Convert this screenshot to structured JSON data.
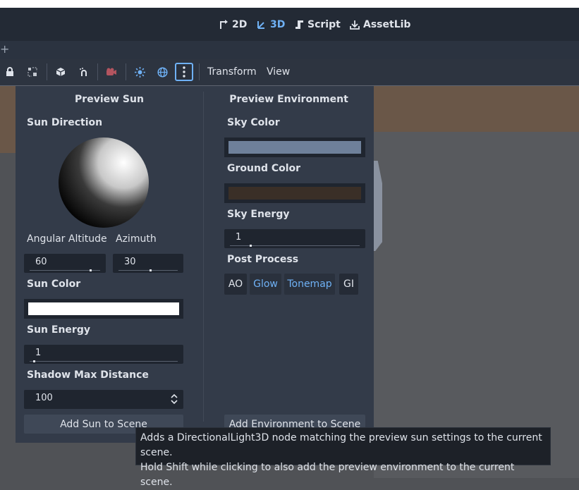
{
  "workspaces": [
    {
      "label": "2D",
      "icon": "2d-workspace-icon"
    },
    {
      "label": "3D",
      "icon": "3d-workspace-icon",
      "active": true
    },
    {
      "label": "Script",
      "icon": "script-icon"
    },
    {
      "label": "AssetLib",
      "icon": "assetlib-icon"
    }
  ],
  "colors": {
    "accent": "#6fb1f5",
    "panel_bg": "#333b49",
    "sky_color": "#6e809a",
    "ground_color": "#3a2f27",
    "sun_color": "#ffffff"
  },
  "toolbar": {
    "icons": [
      "lock-icon",
      "group-icon",
      "cube-icon",
      "snap-icon",
      "film-icon",
      "sun-icon",
      "globe-icon",
      "more-vertical-icon"
    ],
    "transform_label": "Transform",
    "view_label": "View"
  },
  "sun": {
    "heading": "Preview Sun",
    "direction_label": "Sun Direction",
    "altitude_label": "Angular Altitude",
    "azimuth_label": "Azimuth",
    "altitude_value": "60",
    "altitude_fraction": 0.86,
    "azimuth_value": "30",
    "azimuth_fraction": 0.54,
    "color_label": "Sun Color",
    "energy_label": "Sun Energy",
    "energy_value": "1",
    "energy_fraction": 0.03,
    "shadow_label": "Shadow Max Distance",
    "shadow_value": "100",
    "add_button": "Add Sun to Scene"
  },
  "env": {
    "heading": "Preview Environment",
    "sky_color_label": "Sky Color",
    "ground_color_label": "Ground Color",
    "sky_energy_label": "Sky Energy",
    "sky_energy_value": "1",
    "sky_energy_fraction": 0.16,
    "post_process_label": "Post Process",
    "toggles": [
      {
        "label": "AO",
        "on": false
      },
      {
        "label": "Glow",
        "on": true
      },
      {
        "label": "Tonemap",
        "on": true
      },
      {
        "label": "GI",
        "on": false
      }
    ],
    "add_button": "Add Environment to Scene"
  },
  "tooltip": {
    "line1": "Adds a DirectionalLight3D node matching the preview sun settings to the current scene.",
    "line2": "Hold Shift while clicking to also add the preview environment to the current scene."
  }
}
